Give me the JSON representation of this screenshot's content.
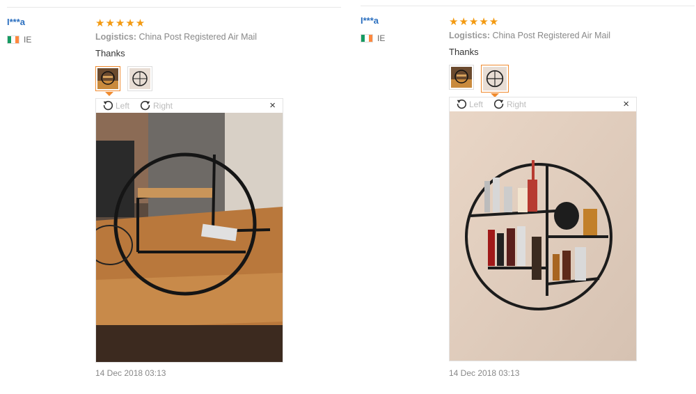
{
  "reviews": [
    {
      "user": "I***a",
      "country": "IE",
      "stars": "★★★★★",
      "logistics_label": "Logistics:",
      "logistics_value": "China Post Registered Air Mail",
      "text": "Thanks",
      "viewer": {
        "left_label": "Left",
        "right_label": "Right",
        "close": "×"
      },
      "date": "14 Dec 2018 03:13"
    },
    {
      "user": "I***a",
      "country": "IE",
      "stars": "★★★★★",
      "logistics_label": "Logistics:",
      "logistics_value": "China Post Registered Air Mail",
      "text": "Thanks",
      "viewer": {
        "left_label": "Left",
        "right_label": "Right",
        "close": "×"
      },
      "date": "14 Dec 2018 03:13"
    }
  ],
  "colors": {
    "username": "#2b6fbf",
    "stars": "#f39a11",
    "active_thumb": "#f08a2e"
  },
  "icons": {
    "rotate_left": "rotate-left-icon",
    "rotate_right": "rotate-right-icon",
    "close": "close-icon",
    "flag": "ireland-flag-icon"
  }
}
